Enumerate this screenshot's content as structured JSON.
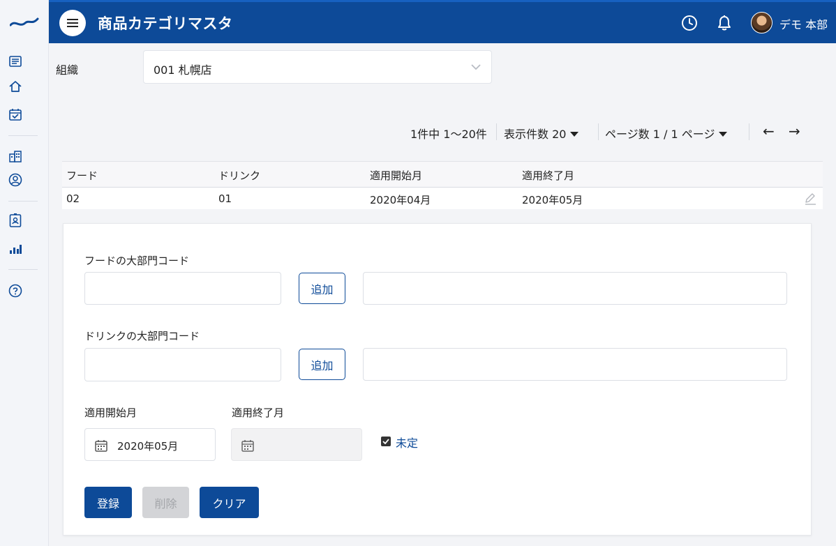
{
  "header": {
    "title": "商品カテゴリマスタ",
    "user_name": "デモ 本部"
  },
  "sidebar": {
    "icons": [
      "brand-logo",
      "list-icon",
      "home-icon",
      "calendar-check-icon",
      "building-icon",
      "user-circle-icon",
      "badge-icon",
      "bar-chart-icon",
      "help-icon"
    ]
  },
  "org": {
    "label": "組織",
    "value": "001 札幌店"
  },
  "pager": {
    "summary": "1件中 1〜20件",
    "per_page": "表示件数 20",
    "page": "ページ数 1 / 1 ページ",
    "prev": "←",
    "next": "→"
  },
  "table": {
    "columns": [
      "フード",
      "ドリンク",
      "適用開始月",
      "適用終了月"
    ],
    "rows": [
      [
        "02",
        "01",
        "2020年04月",
        "2020年05月"
      ]
    ]
  },
  "form": {
    "food_label": "フードの大部門コード",
    "drink_label": "ドリンクの大部門コード",
    "add_label": "追加",
    "start_label": "適用開始月",
    "end_label": "適用終了月",
    "start_value": "2020年05月",
    "undetermined_label": "未定",
    "undetermined_checked": true,
    "register_label": "登録",
    "delete_label": "削除",
    "clear_label": "クリア"
  },
  "colors": {
    "brand": "#0d4a98",
    "header_bg": "#0d4a98"
  }
}
